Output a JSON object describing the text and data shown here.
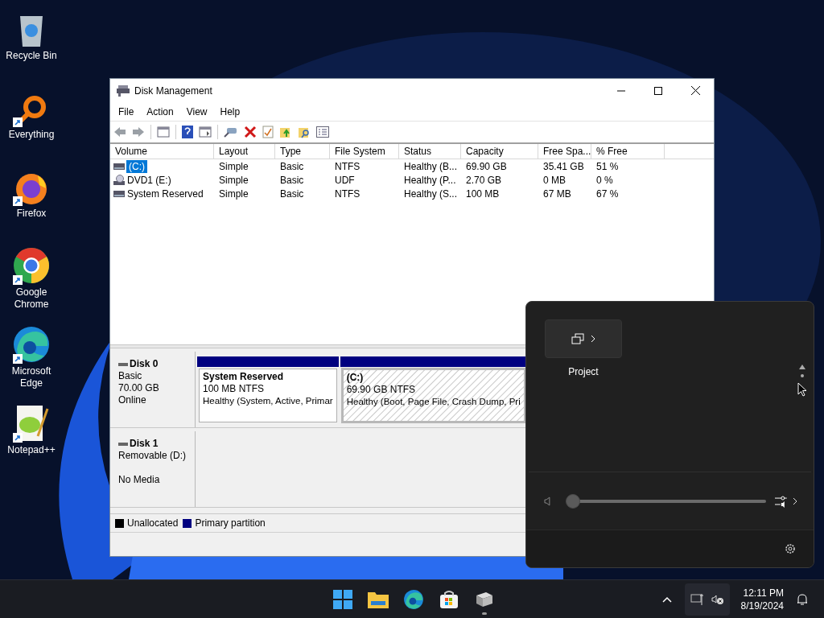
{
  "desktop_icons": [
    {
      "label": "Recycle Bin",
      "kind": "recycle-bin",
      "shortcut": false
    },
    {
      "label": "Everything",
      "kind": "everything",
      "shortcut": true
    },
    {
      "label": "Firefox",
      "kind": "firefox",
      "shortcut": true
    },
    {
      "label": "Google Chrome",
      "kind": "chrome",
      "shortcut": true
    },
    {
      "label": "Microsoft Edge",
      "kind": "edge",
      "shortcut": true
    },
    {
      "label": "Notepad++",
      "kind": "notepad",
      "shortcut": true
    }
  ],
  "window": {
    "title": "Disk Management",
    "menu": [
      "File",
      "Action",
      "View",
      "Help"
    ],
    "columns": [
      "Volume",
      "Layout",
      "Type",
      "File System",
      "Status",
      "Capacity",
      "Free Spa...",
      "% Free"
    ],
    "rows": [
      {
        "kind": "hdd",
        "selected": true,
        "cells": [
          "(C:)",
          "Simple",
          "Basic",
          "NTFS",
          "Healthy (B...",
          "69.90 GB",
          "35.41 GB",
          "51 %"
        ]
      },
      {
        "kind": "dvd",
        "selected": false,
        "cells": [
          "DVD1 (E:)",
          "Simple",
          "Basic",
          "UDF",
          "Healthy (P...",
          "2.70 GB",
          "0 MB",
          "0 %"
        ]
      },
      {
        "kind": "hdd",
        "selected": false,
        "cells": [
          "System Reserved",
          "Simple",
          "Basic",
          "NTFS",
          "Healthy (S...",
          "100 MB",
          "67 MB",
          "67 %"
        ]
      }
    ],
    "disks": [
      {
        "name": "Disk 0",
        "type": "Basic",
        "size": "70.00 GB",
        "status": "Online",
        "partitions": [
          {
            "title": "System Reserved",
            "size": "100 MB NTFS",
            "status": "Healthy (System, Active, Primar",
            "selected": false
          },
          {
            "title": "(C:)",
            "size": "69.90 GB NTFS",
            "status": "Healthy (Boot, Page File, Crash Dump, Pri",
            "selected": true
          }
        ]
      },
      {
        "name": "Disk 1",
        "type": "Removable (D:)",
        "status": "No Media"
      }
    ],
    "legend": [
      {
        "label": "Unallocated",
        "color": "#000000"
      },
      {
        "label": "Primary partition",
        "color": "#000080"
      }
    ]
  },
  "quick_settings": {
    "tiles": [
      {
        "label": "Project",
        "kind": "project"
      }
    ],
    "volume": {
      "level": 0
    }
  },
  "taskbar": {
    "apps": [
      {
        "kind": "start",
        "running": false
      },
      {
        "kind": "explorer",
        "running": false
      },
      {
        "kind": "edge",
        "running": false
      },
      {
        "kind": "store",
        "running": false
      },
      {
        "kind": "disk-app",
        "running": true
      }
    ],
    "time": "12:11 PM",
    "date": "8/19/2024"
  }
}
